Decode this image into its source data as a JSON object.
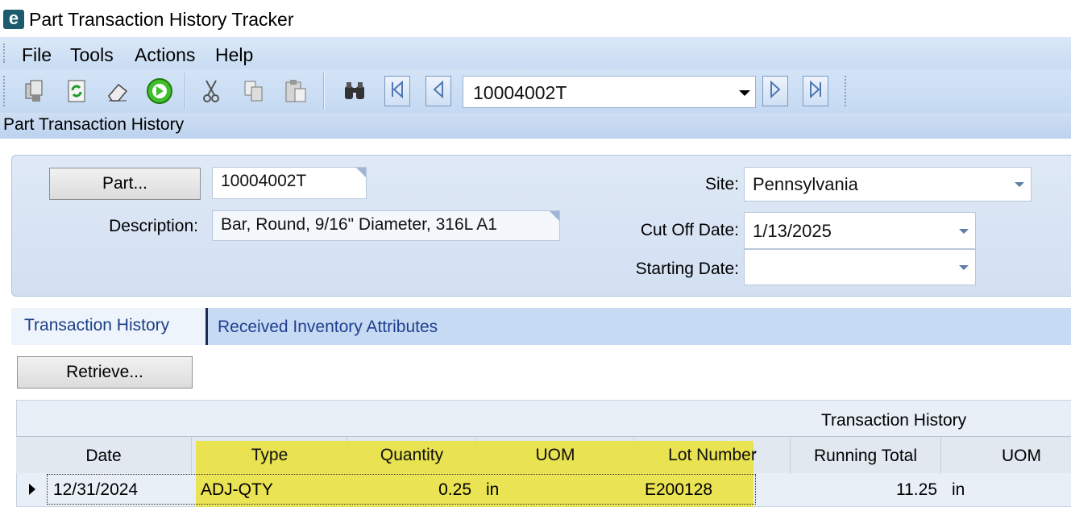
{
  "window": {
    "title": "Part Transaction History Tracker",
    "logo_letter": "e"
  },
  "menu": {
    "items": [
      "File",
      "Tools",
      "Actions",
      "Help"
    ]
  },
  "toolbar": {
    "icons": [
      "copy-icon",
      "refresh-icon",
      "eraser-icon",
      "go-icon",
      "cut-icon",
      "paste-copy-icon",
      "clipboard-icon",
      "find-icon",
      "first-record-icon",
      "previous-record-icon",
      "next-record-icon",
      "last-record-icon"
    ],
    "record_value": "10004002T"
  },
  "section": {
    "title": "Part Transaction History"
  },
  "form": {
    "part_button": "Part...",
    "part_value": "10004002T",
    "description_label": "Description:",
    "description_value": "Bar, Round, 9/16\" Diameter, 316L A1",
    "site_label": "Site:",
    "site_value": "Pennsylvania",
    "cutoff_label": "Cut Off Date:",
    "cutoff_value": "1/13/2025",
    "starting_label": "Starting Date:",
    "starting_value": ""
  },
  "tabs": [
    {
      "label": "Transaction History",
      "active": true
    },
    {
      "label": "Received Inventory Attributes",
      "active": false
    }
  ],
  "grid": {
    "retrieve_button": "Retrieve...",
    "caption": "Transaction History",
    "columns": [
      "Date",
      "Type",
      "Quantity",
      "UOM",
      "Lot Number",
      "Running Total",
      "UOM"
    ],
    "rows": [
      {
        "date": "12/31/2024",
        "type": "ADJ-QTY",
        "quantity": "0.25",
        "uom": "in",
        "lot_number": "E200128",
        "running_total": "11.25",
        "uom2": "in"
      }
    ],
    "highlight_color": "#e9e244"
  }
}
